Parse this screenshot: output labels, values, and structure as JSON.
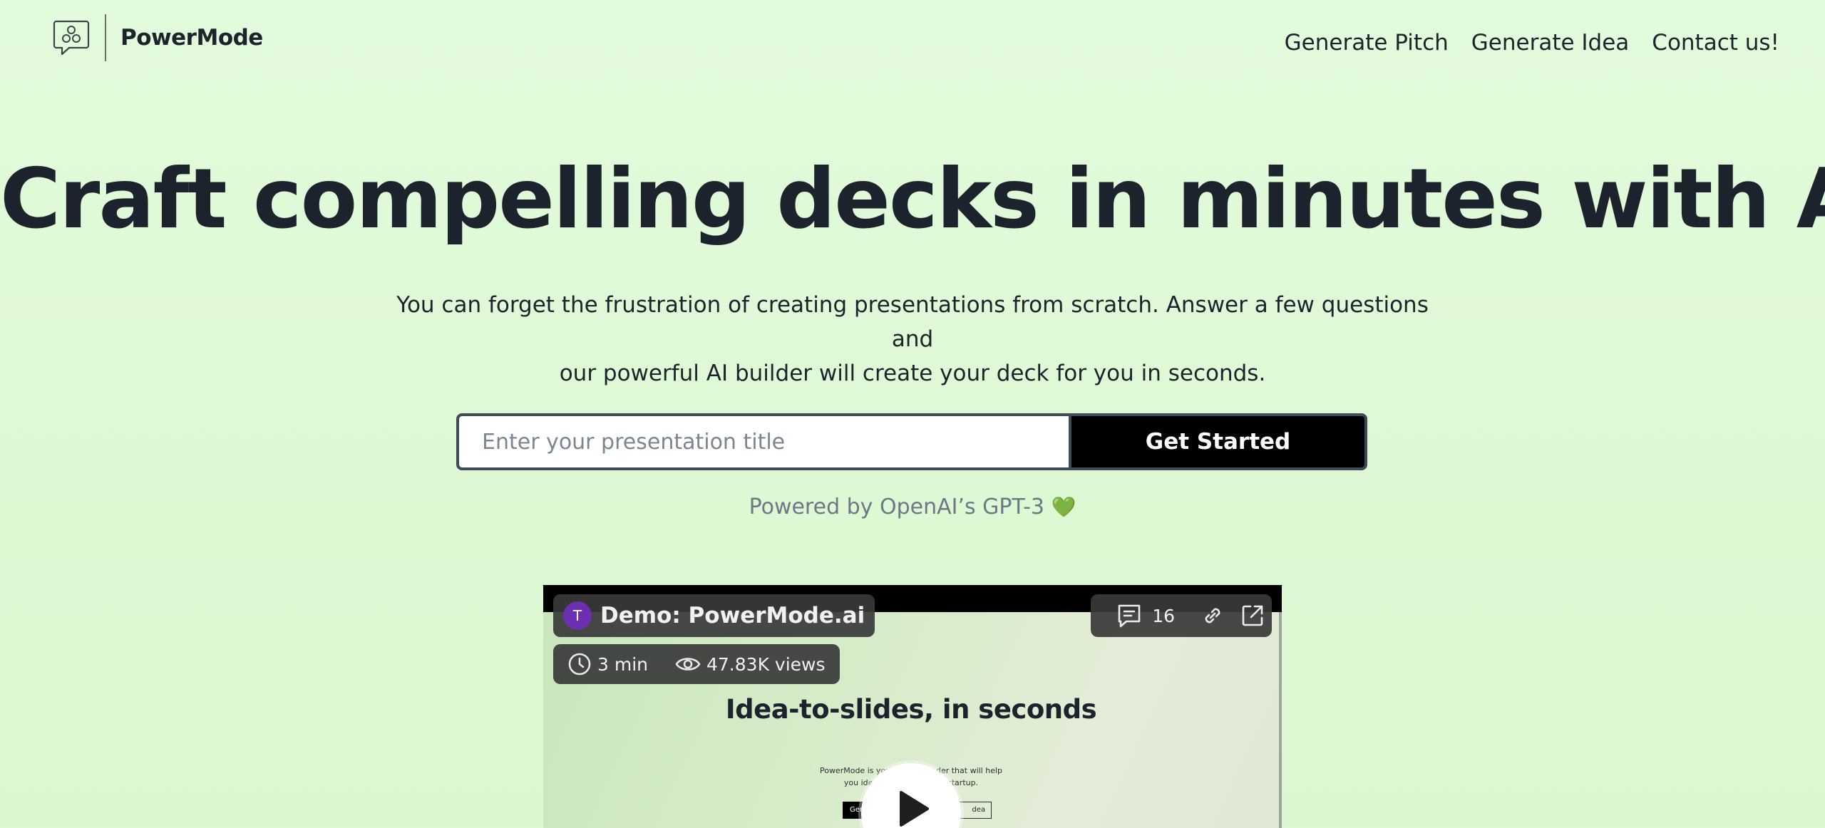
{
  "header": {
    "brand": "PowerMode",
    "logo_icon": "chat-bubble-molecule-icon",
    "nav": [
      {
        "label": "Generate Pitch"
      },
      {
        "label": "Generate Idea"
      },
      {
        "label": "Contact us!"
      }
    ]
  },
  "hero": {
    "title": "Craft compelling decks in minutes with AI",
    "subtitle_line1": "You can forget the frustration of creating presentations from scratch. Answer a few questions and",
    "subtitle_line2": "our powerful AI builder will create your deck for you in seconds."
  },
  "form": {
    "input_placeholder": "Enter your presentation title",
    "input_value": "",
    "button_label": "Get Started"
  },
  "powered_by": {
    "text": "Powered by OpenAI’s GPT-3",
    "emoji": "💚"
  },
  "video": {
    "avatar_initial": "T",
    "title": "Demo: PowerMode.ai",
    "duration": "3 min",
    "views": "47.83K views",
    "comments_count": "16",
    "icons": [
      "comment-icon",
      "link-icon",
      "external-link-icon",
      "clock-icon",
      "eye-icon",
      "play-icon"
    ],
    "slide": {
      "title": "Idea-to-slides, in seconds",
      "desc_line1": "PowerMode is your AI co-founder that will help",
      "desc_line2": "you ideate and pitch your startup.",
      "btn_dark": "Gene",
      "btn_light": "dea"
    }
  },
  "colors": {
    "background": "#e0f9d9",
    "text": "#1c232d",
    "muted": "#6b7886",
    "button_bg": "#000000",
    "avatar": "#6d2fb1",
    "heart": "#67c04f"
  }
}
